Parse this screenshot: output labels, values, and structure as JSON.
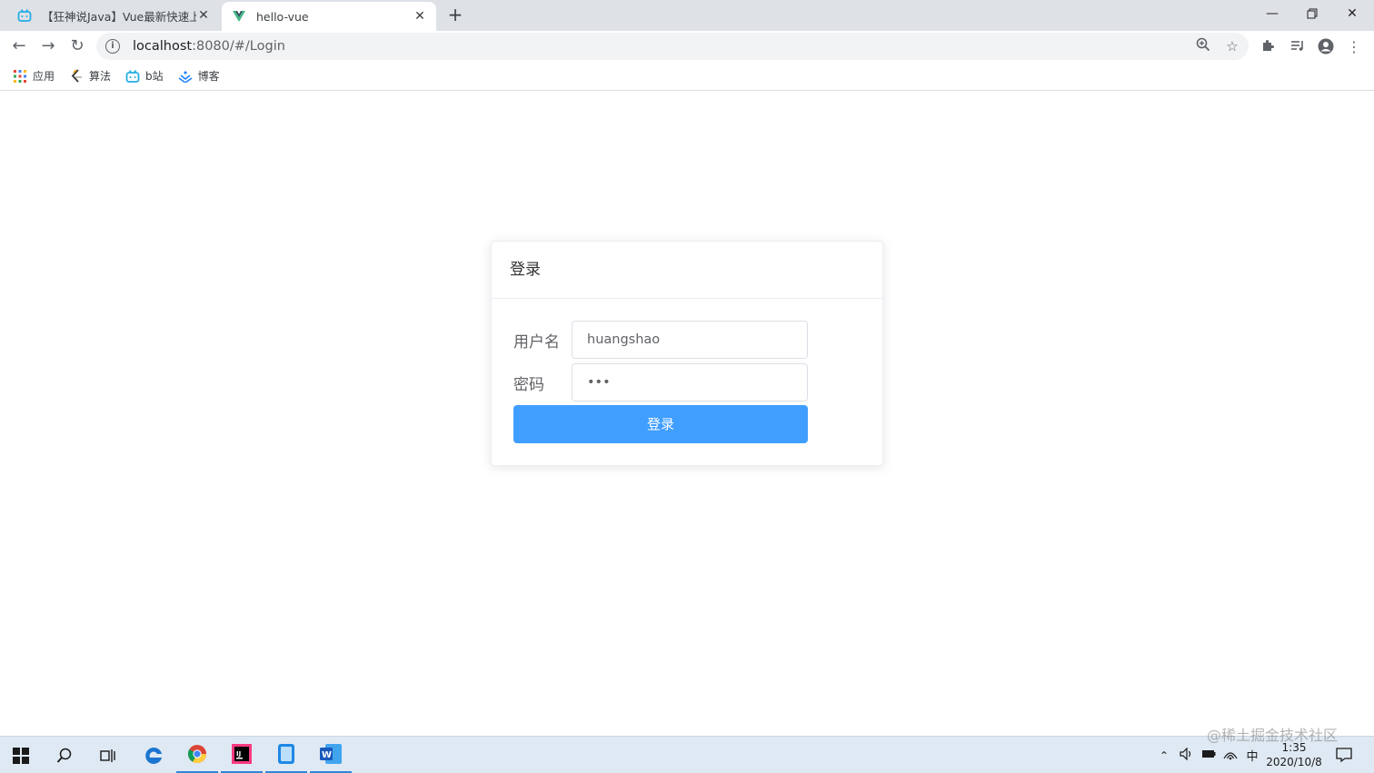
{
  "browser": {
    "tabs": [
      {
        "title": "【狂神说Java】Vue最新快速上手",
        "icon": "bilibili-icon",
        "active": false
      },
      {
        "title": "hello-vue",
        "icon": "vue-icon",
        "active": true
      }
    ],
    "address": {
      "host": "localhost",
      "path": ":8080/#/Login"
    },
    "bookmarks": [
      {
        "label": "应用",
        "icon": "apps-grid-icon"
      },
      {
        "label": "算法",
        "icon": "leetcode-icon"
      },
      {
        "label": "b站",
        "icon": "bilibili-icon"
      },
      {
        "label": "博客",
        "icon": "juejin-icon"
      }
    ]
  },
  "login": {
    "title": "登录",
    "username_label": "用户名",
    "username_value": "huangshao",
    "password_label": "密码",
    "password_value": "•••",
    "submit_label": "登录"
  },
  "taskbar": {
    "apps": [
      "windows-start-icon",
      "search-icon",
      "task-view-icon",
      "edge-icon",
      "chrome-icon",
      "intellij-icon",
      "tablet-app-icon",
      "word-icon"
    ],
    "ime": "中",
    "time": "1:35",
    "date": "2020/10/8"
  },
  "watermark": "@稀土掘金技术社区",
  "colors": {
    "primary": "#409eff",
    "tab_strip": "#dee1e6",
    "taskbar": "#dfe9f3"
  }
}
